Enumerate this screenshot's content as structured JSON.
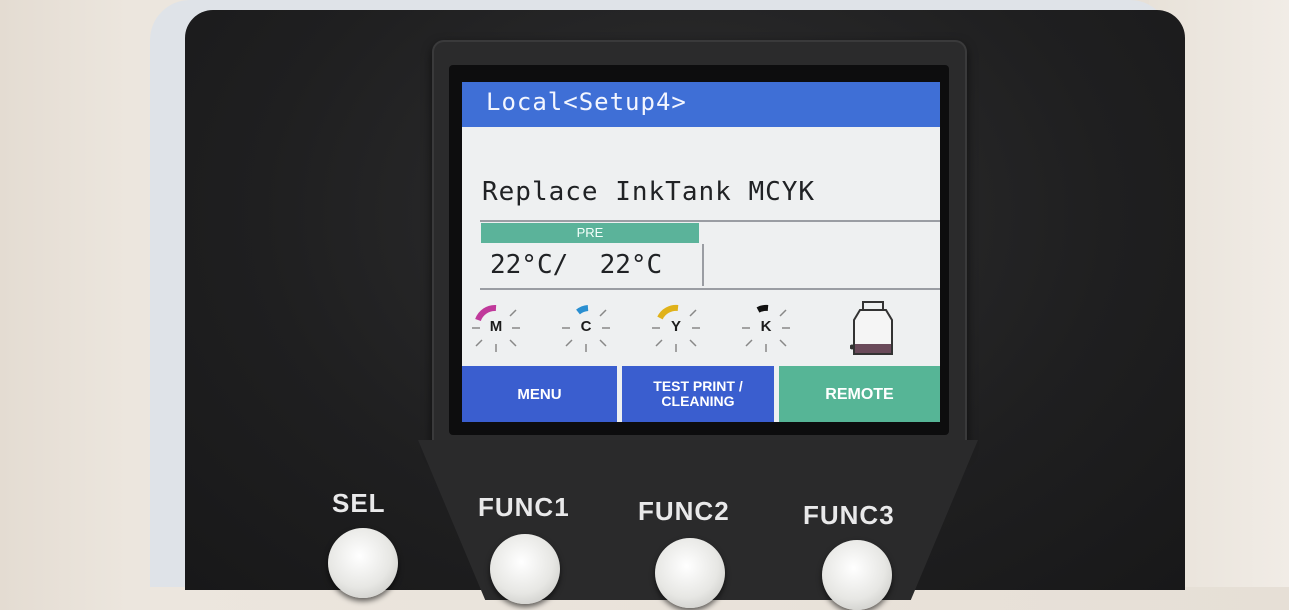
{
  "screen": {
    "title": "Local<Setup4>",
    "message": "Replace InkTank MCYK",
    "pre_label": "PRE",
    "temperature": "22°C/  22°C",
    "inks": [
      {
        "letter": "M",
        "color": "#c0399b"
      },
      {
        "letter": "C",
        "color": "#2a8fd1"
      },
      {
        "letter": "Y",
        "color": "#e0b21a"
      },
      {
        "letter": "K",
        "color": "#111111"
      }
    ],
    "waste_icon": "waste-ink-bottle-icon",
    "softkeys": {
      "menu": "MENU",
      "test_line1": "TEST PRINT /",
      "test_line2": "CLEANING",
      "remote": "REMOTE"
    }
  },
  "keys": {
    "sel": "SEL",
    "func1": "FUNC1",
    "func2": "FUNC2",
    "func3": "FUNC3"
  },
  "colors": {
    "title_bar": "#3f6fd6",
    "softkey_blue": "#3a5ecf",
    "softkey_green": "#56b596",
    "pre_label": "#5bb39a"
  }
}
